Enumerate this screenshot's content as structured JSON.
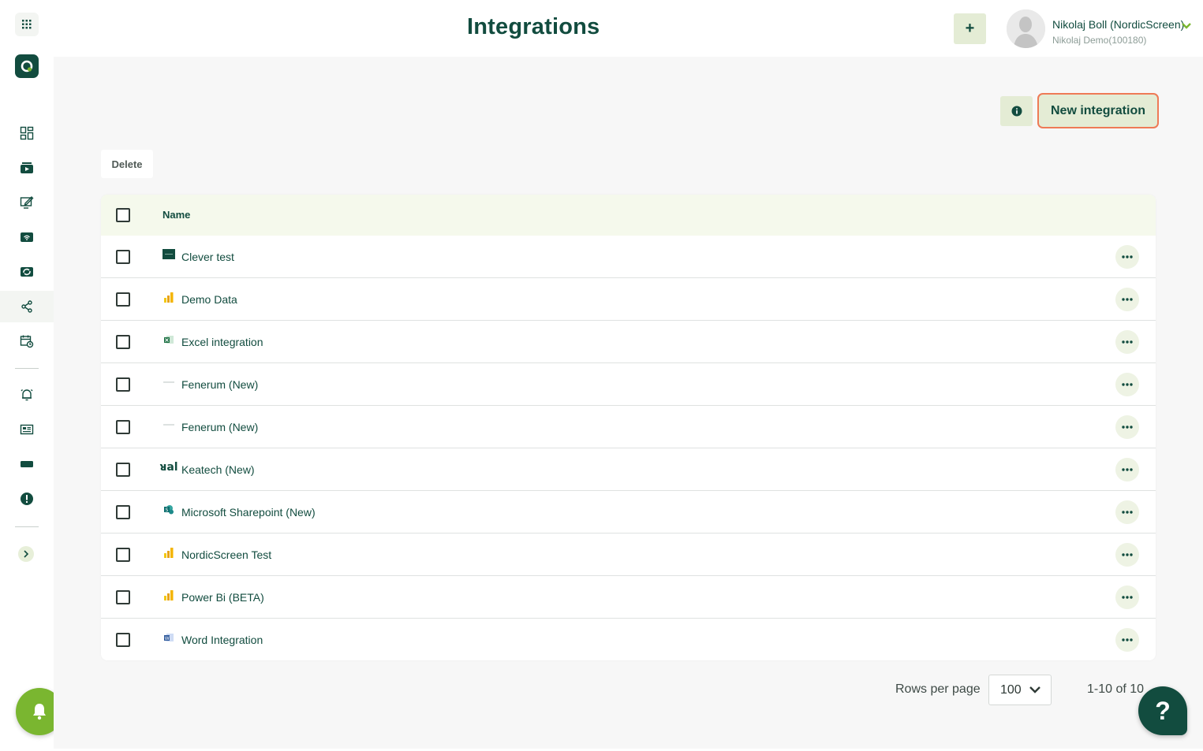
{
  "header": {
    "title": "Integrations",
    "add_label": "+",
    "user_name": "Nikolaj Boll (NordicScreen)",
    "user_org": "Nikolaj Demo(100180)"
  },
  "toolbar": {
    "new_integration_label": "New integration",
    "delete_label": "Delete"
  },
  "sidebar": {
    "items": [
      {
        "icon": "dashboard-icon"
      },
      {
        "icon": "media-icon"
      },
      {
        "icon": "edit-screen-icon"
      },
      {
        "icon": "screens-icon"
      },
      {
        "icon": "playlist-icon"
      },
      {
        "icon": "integrations-icon",
        "active": true
      },
      {
        "icon": "schedule-icon"
      },
      {
        "icon": "alarm-icon"
      },
      {
        "icon": "newsfeed-icon"
      },
      {
        "icon": "ticker-icon"
      },
      {
        "icon": "alert-icon"
      }
    ]
  },
  "table": {
    "header_name": "Name",
    "rows": [
      {
        "name": "Clever test",
        "icon": "clever-icon"
      },
      {
        "name": "Demo Data",
        "icon": "powerbi-icon"
      },
      {
        "name": "Excel integration",
        "icon": "excel-icon"
      },
      {
        "name": "Fenerum (New)",
        "icon": "fenerum-icon"
      },
      {
        "name": "Fenerum (New)",
        "icon": "fenerum-icon"
      },
      {
        "name": "Keatech (New)",
        "icon": "keatech-icon",
        "icon_text": "ᴚal"
      },
      {
        "name": "Microsoft Sharepoint (New)",
        "icon": "sharepoint-icon"
      },
      {
        "name": "NordicScreen Test",
        "icon": "powerbi-icon"
      },
      {
        "name": "Power Bi (BETA)",
        "icon": "powerbi-icon"
      },
      {
        "name": "Word Integration",
        "icon": "word-icon"
      }
    ]
  },
  "pagination": {
    "rows_per_page_label": "Rows per page",
    "rows_per_page_value": "100",
    "range": "1-10 of 10"
  },
  "help_label": "?",
  "colors": {
    "brand_dark": "#124c3f",
    "brand_light": "#e4ecd5",
    "accent_green": "#7ab630",
    "highlight_orange": "#ee7a56"
  }
}
